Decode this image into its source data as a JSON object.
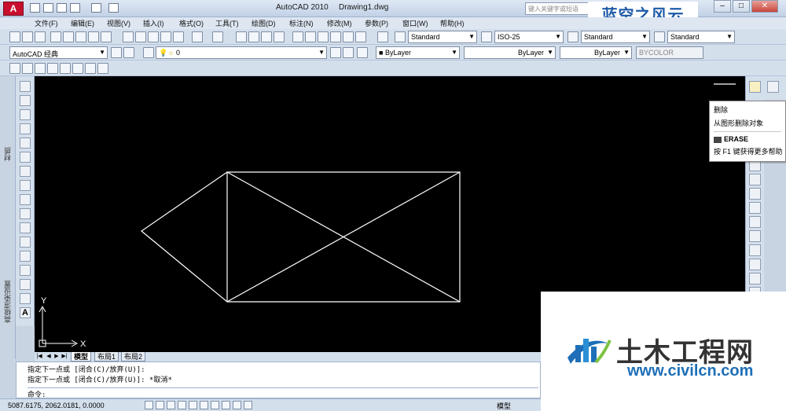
{
  "titlebar": {
    "app_title": "AutoCAD 2010",
    "doc_title": "Drawing1.dwg",
    "search_placeholder": "键入关键字或短语",
    "logo": "A"
  },
  "watermark_top": "蓝空之风云",
  "menu": [
    "文件(F)",
    "编辑(E)",
    "视图(V)",
    "插入(I)",
    "格式(O)",
    "工具(T)",
    "绘图(D)",
    "标注(N)",
    "修改(M)",
    "参数(P)",
    "窗口(W)",
    "帮助(H)"
  ],
  "styles": {
    "text_style": "Standard",
    "dim_style": "ISO-25",
    "table_style": "Standard",
    "multileader_style": "Standard"
  },
  "workspace": "AutoCAD 经典",
  "layer": "0",
  "properties": {
    "color": "ByLayer",
    "linetype": "ByLayer",
    "lineweight": "ByLayer",
    "plotstyle": "BYCOLOR"
  },
  "palettes": {
    "left_top": "材质",
    "left_bottom": "高级渲染设置"
  },
  "tooltip": {
    "title": "删除",
    "description": "从图形删除对象",
    "command": "ERASE",
    "help": "按 F1 键获得更多帮助"
  },
  "ucs": {
    "x_label": "X",
    "y_label": "Y"
  },
  "layout_tabs": [
    "模型",
    "布局1",
    "布局2"
  ],
  "command": {
    "history": [
      "指定下一点或 [闭合(C)/放弃(U)]:",
      "指定下一点或 [闭合(C)/放弃(U)]: *取消*"
    ],
    "prompt": "命令:"
  },
  "status": {
    "coordinates": "5087.6175, 2062.0181, 0.0000",
    "model_label": "模型"
  },
  "watermark_br": {
    "name": "土木工程网",
    "url": "www.civilcn.com"
  },
  "colors": {
    "canvas": "#000000",
    "line": "#ffffff",
    "ribbon": "#d4dfec",
    "accent": "#1e6fb8"
  }
}
